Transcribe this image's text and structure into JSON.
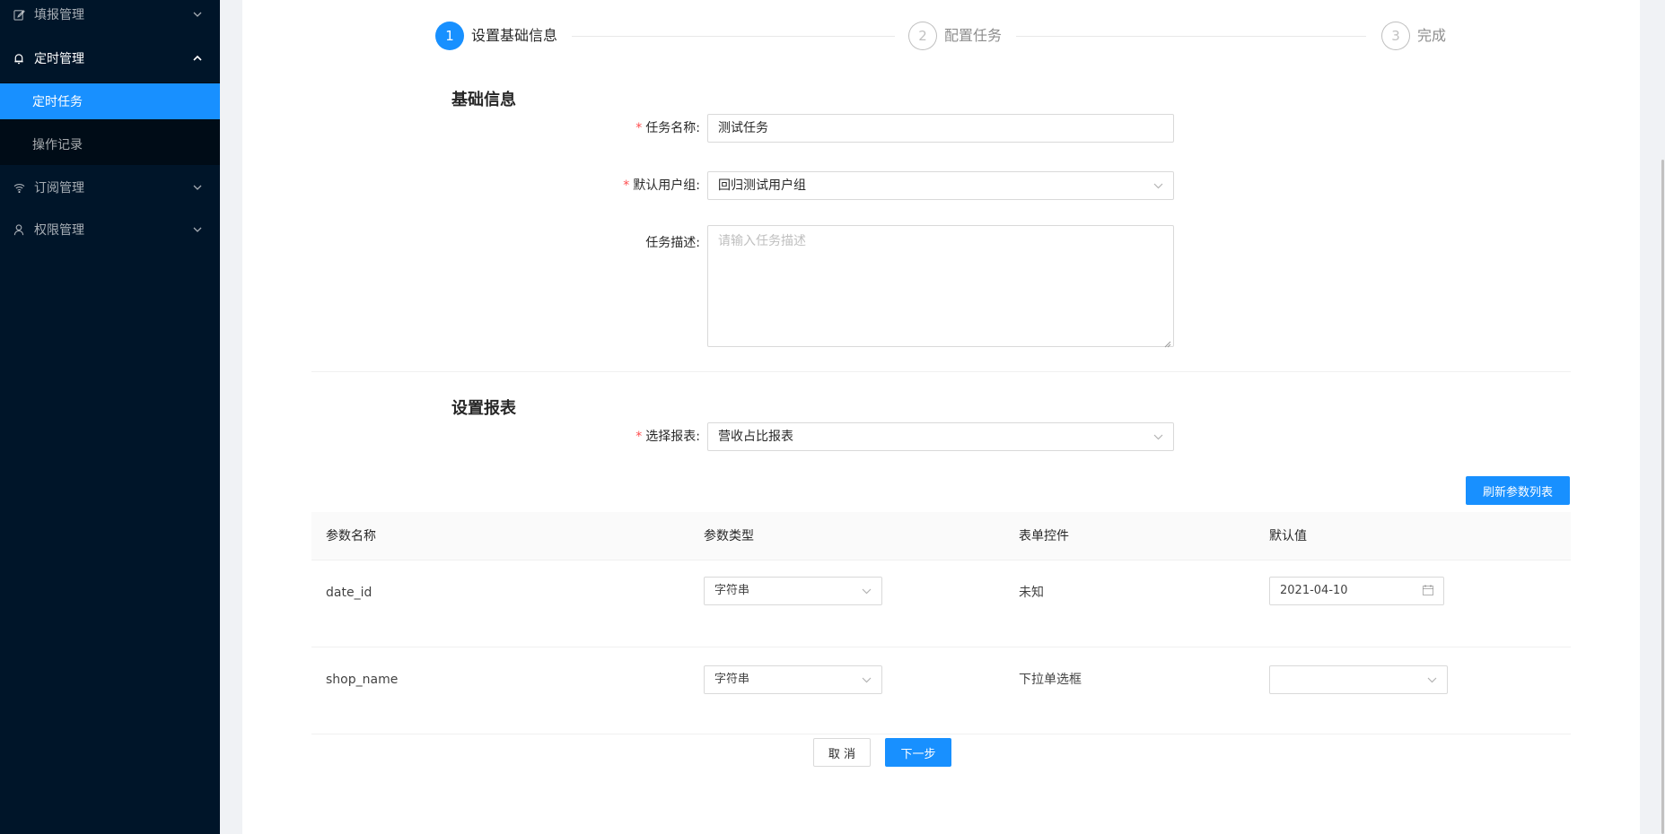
{
  "sidebar": {
    "items": [
      {
        "label": "填报管理",
        "icon": "edit-icon",
        "expanded": false
      },
      {
        "label": "定时管理",
        "icon": "bell-icon",
        "expanded": true
      },
      {
        "label": "订阅管理",
        "icon": "wifi-icon",
        "expanded": false
      },
      {
        "label": "权限管理",
        "icon": "user-icon",
        "expanded": false
      }
    ],
    "subitems": [
      {
        "label": "定时任务",
        "active": true
      },
      {
        "label": "操作记录",
        "active": false
      }
    ]
  },
  "steps": [
    {
      "number": "1",
      "title": "设置基础信息",
      "status": "process"
    },
    {
      "number": "2",
      "title": "配置任务",
      "status": "wait"
    },
    {
      "number": "3",
      "title": "完成",
      "status": "wait"
    }
  ],
  "basic_info": {
    "section_title": "基础信息",
    "task_name_label": "任务名称:",
    "task_name_value": "测试任务",
    "user_group_label": "默认用户组:",
    "user_group_value": "回归测试用户组",
    "task_desc_label": "任务描述:",
    "task_desc_placeholder": "请输入任务描述"
  },
  "report": {
    "section_title": "设置报表",
    "select_report_label": "选择报表:",
    "select_report_value": "营收占比报表",
    "refresh_button": "刷新参数列表"
  },
  "table": {
    "headers": [
      "参数名称",
      "参数类型",
      "表单控件",
      "默认值"
    ],
    "rows": [
      {
        "name": "date_id",
        "type": "字符串",
        "control": "未知",
        "default": "2021-04-10"
      },
      {
        "name": "shop_name",
        "type": "字符串",
        "control": "下拉单选框",
        "default": ""
      }
    ]
  },
  "footer": {
    "cancel_button": "取 消",
    "next_button": "下一步"
  },
  "colors": {
    "primary": "#1890ff",
    "sidebar_bg": "#001529",
    "required": "#ff4d4f"
  }
}
